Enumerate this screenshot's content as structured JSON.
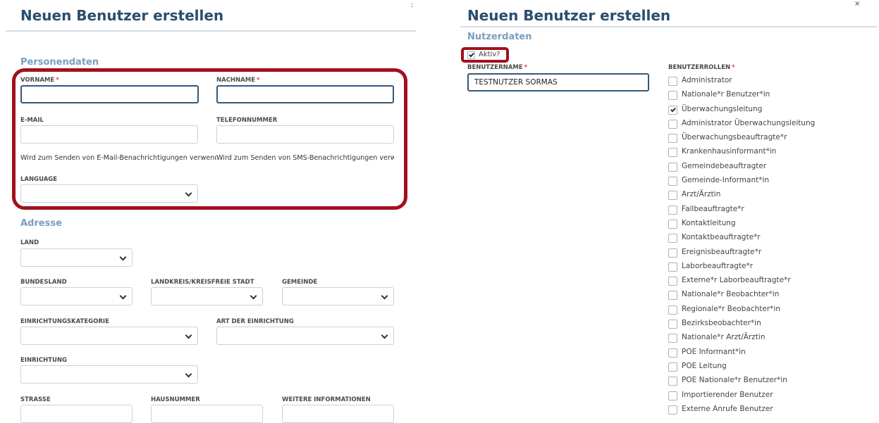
{
  "left_dialog": {
    "title": "Neuen Benutzer erstellen",
    "menu_glyph": ":",
    "personendaten": {
      "heading": "Personendaten",
      "vorname": {
        "label": "VORNAME",
        "required_mark": "*",
        "value": ""
      },
      "nachname": {
        "label": "NACHNAME",
        "required_mark": "*",
        "value": ""
      },
      "email": {
        "label": "E-MAIL",
        "value": "",
        "help": "Wird zum Senden von E-Mail-Benachrichtigungen verwendet"
      },
      "telefon": {
        "label": "TELEFONNUMMER",
        "value": "",
        "help": "Wird zum Senden von SMS-Benachrichtigungen verwendet"
      },
      "language": {
        "label": "LANGUAGE",
        "selected": ""
      }
    },
    "adresse": {
      "heading": "Adresse",
      "land": {
        "label": "LAND",
        "selected": ""
      },
      "bundesland": {
        "label": "BUNDESLAND",
        "selected": ""
      },
      "landkreis": {
        "label": "LANDKREIS/KREISFREIE STADT",
        "selected": ""
      },
      "gemeinde": {
        "label": "GEMEINDE",
        "selected": ""
      },
      "einrichtungskategorie": {
        "label": "EINRICHTUNGSKATEGORIE",
        "selected": ""
      },
      "art_der_einrichtung": {
        "label": "ART DER EINRICHTUNG",
        "selected": ""
      },
      "einrichtung": {
        "label": "EINRICHTUNG",
        "selected": ""
      },
      "strasse": {
        "label": "STRASSE",
        "value": ""
      },
      "hausnummer": {
        "label": "HAUSNUMMER",
        "value": ""
      },
      "weitere_informationen": {
        "label": "WEITERE INFORMATIONEN",
        "value": ""
      }
    }
  },
  "right_dialog": {
    "title": "Neuen Benutzer erstellen",
    "close_glyph": "×",
    "nutzerdaten": {
      "heading": "Nutzerdaten",
      "aktiv": {
        "label": "Aktiv?",
        "checked": true
      },
      "benutzername": {
        "label": "BENUTZERNAME",
        "required_mark": "*",
        "value": "TESTNUTZER SORMAS"
      },
      "benutzerrollen": {
        "label": "BENUTZERROLLEN",
        "required_mark": "*",
        "roles": [
          {
            "label": "Administrator",
            "checked": false
          },
          {
            "label": "Nationale*r Benutzer*in",
            "checked": false
          },
          {
            "label": "Überwachungsleitung",
            "checked": true
          },
          {
            "label": "Administrator Überwachungsleitung",
            "checked": false
          },
          {
            "label": "Überwachungsbeauftragte*r",
            "checked": false
          },
          {
            "label": "Krankenhausinformant*in",
            "checked": false
          },
          {
            "label": "Gemeindebeauftragter",
            "checked": false
          },
          {
            "label": "Gemeinde-Informant*in",
            "checked": false
          },
          {
            "label": "Arzt/Ärztin",
            "checked": false
          },
          {
            "label": "Fallbeauftragte*r",
            "checked": false
          },
          {
            "label": "Kontaktleitung",
            "checked": false
          },
          {
            "label": "Kontaktbeauftragte*r",
            "checked": false
          },
          {
            "label": "Ereignisbeauftragte*r",
            "checked": false
          },
          {
            "label": "Laborbeauftragte*r",
            "checked": false
          },
          {
            "label": "Externe*r Laborbeauftragte*r",
            "checked": false
          },
          {
            "label": "Nationale*r Beobachter*in",
            "checked": false
          },
          {
            "label": "Regionale*r Beobachter*in",
            "checked": false
          },
          {
            "label": "Bezirksbeobachter*in",
            "checked": false
          },
          {
            "label": "Nationale*r Arzt/Ärztin",
            "checked": false
          },
          {
            "label": "POE Informant*in",
            "checked": false
          },
          {
            "label": "POE Leitung",
            "checked": false
          },
          {
            "label": "POE Nationale*r Benutzer*in",
            "checked": false
          },
          {
            "label": "Importierender Benutzer",
            "checked": false
          },
          {
            "label": "Externe Anrufe Benutzer",
            "checked": false
          }
        ]
      }
    }
  },
  "colors": {
    "title": "#2b4d6f",
    "section_heading": "#7b9dbf",
    "highlight": "#a3101c",
    "required": "#e03b3b",
    "focused_border": "#34597d"
  }
}
